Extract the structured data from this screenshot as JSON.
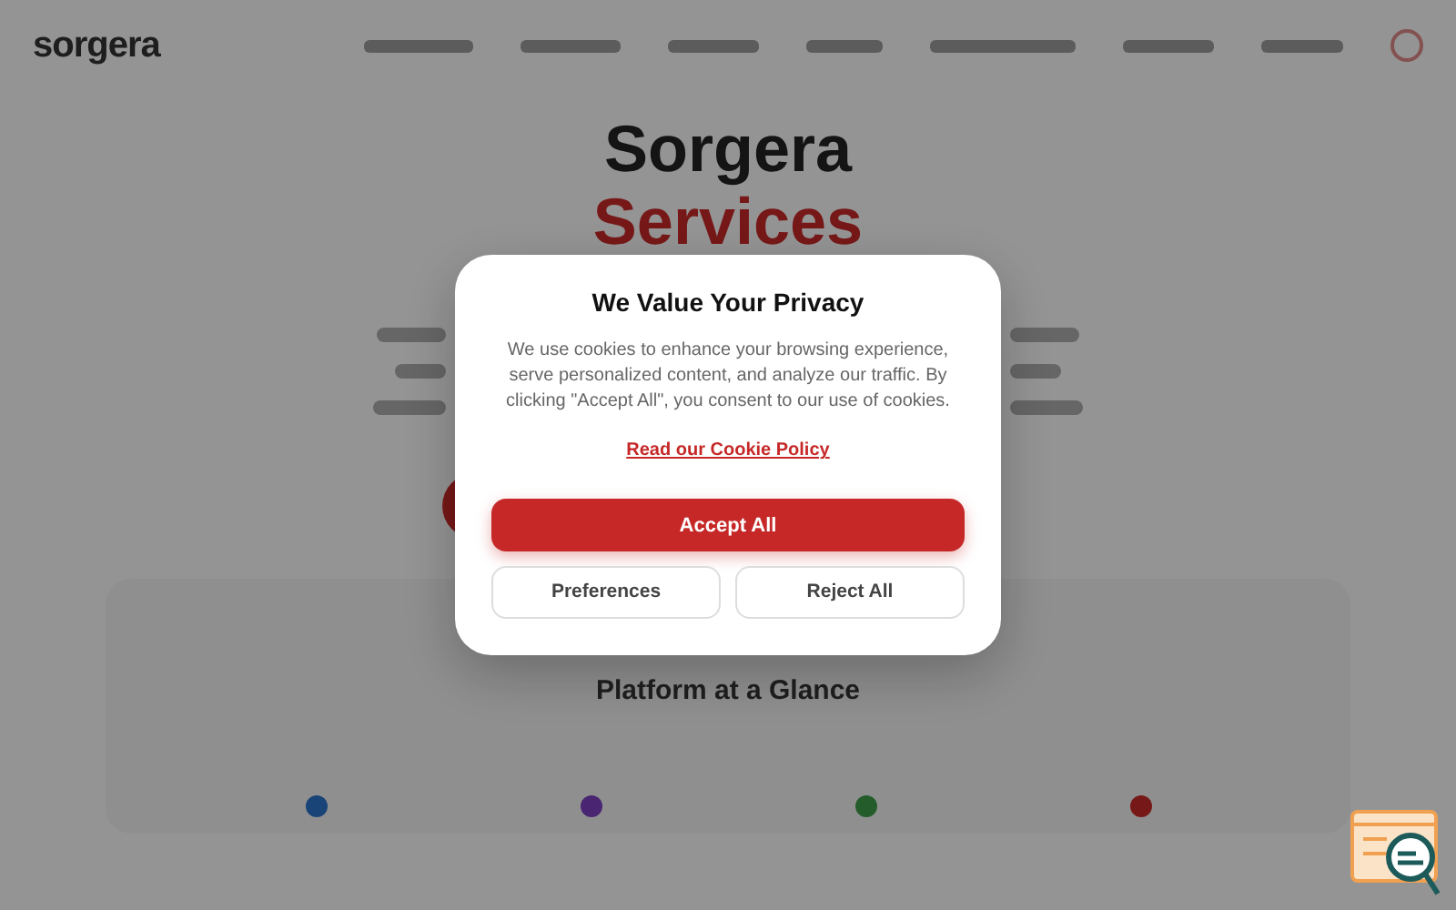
{
  "background": {
    "logo": "sorgera",
    "hero_title": "Sorgera",
    "hero_subtitle": "Services",
    "section_title": "Platform at a Glance"
  },
  "cookie_dialog": {
    "title": "We Value Your Privacy",
    "body": "We use cookies to enhance your browsing experience, serve personalized content, and analyze our traffic. By clicking \"Accept All\", you consent to our use of cookies.",
    "link": "Read our Cookie Policy",
    "buttons": [
      {
        "label": "Accept All",
        "kind": "primary"
      },
      {
        "label": "Preferences",
        "kind": "secondary"
      },
      {
        "label": "Reject All",
        "kind": "secondary"
      }
    ]
  }
}
